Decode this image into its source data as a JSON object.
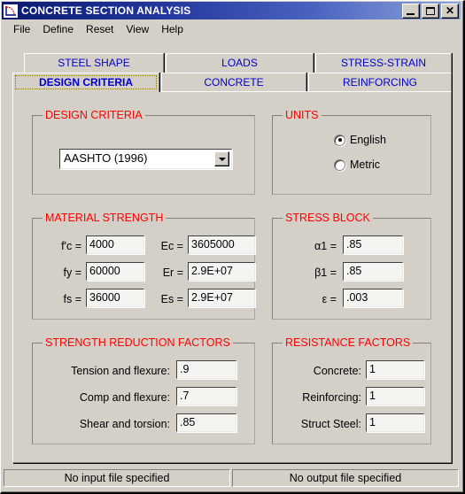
{
  "window": {
    "title": "CONCRETE SECTION ANALYSIS",
    "icon": "concrete-section-icon",
    "controls": {
      "minimize": "minimize-icon",
      "maximize": "maximize-icon",
      "close": "close-icon"
    }
  },
  "menu": {
    "items": [
      {
        "label": "File"
      },
      {
        "label": "Define"
      },
      {
        "label": "Reset"
      },
      {
        "label": "View"
      },
      {
        "label": "Help"
      }
    ]
  },
  "tabs": {
    "rows": [
      [
        {
          "label": "STEEL SHAPE",
          "selected": false
        },
        {
          "label": "LOADS",
          "selected": false
        },
        {
          "label": "STRESS-STRAIN",
          "selected": false
        }
      ],
      [
        {
          "label": "DESIGN CRITERIA",
          "selected": true
        },
        {
          "label": "CONCRETE",
          "selected": false
        },
        {
          "label": "REINFORCING",
          "selected": false
        }
      ]
    ],
    "selected": "DESIGN CRITERIA"
  },
  "groups": {
    "design_criteria": {
      "legend": "DESIGN CRITERIA",
      "combo": {
        "value": "AASHTO (1996)",
        "arrow_icon": "chevron-down-icon"
      }
    },
    "units": {
      "legend": "UNITS",
      "options": [
        {
          "label": "English",
          "selected": true
        },
        {
          "label": "Metric",
          "selected": false
        }
      ]
    },
    "material_strength": {
      "legend": "MATERIAL STRENGTH",
      "fields": [
        {
          "label": "f'c =",
          "value": "4000"
        },
        {
          "label": "fy =",
          "value": "60000"
        },
        {
          "label": "fs =",
          "value": "36000"
        },
        {
          "label": "Ec =",
          "value": "3605000"
        },
        {
          "label": "Er =",
          "value": "2.9E+07"
        },
        {
          "label": "Es =",
          "value": "2.9E+07"
        }
      ]
    },
    "stress_block": {
      "legend": "STRESS BLOCK",
      "fields": [
        {
          "label": "α1 =",
          "value": ".85"
        },
        {
          "label": "β1 =",
          "value": ".85"
        },
        {
          "label": "ε =",
          "value": ".003"
        }
      ]
    },
    "strength_reduction": {
      "legend": "STRENGTH REDUCTION FACTORS",
      "fields": [
        {
          "label": "Tension and flexure:",
          "value": ".9"
        },
        {
          "label": "Comp and flexure:",
          "value": ".7"
        },
        {
          "label": "Shear and torsion:",
          "value": ".85"
        }
      ]
    },
    "resistance_factors": {
      "legend": "RESISTANCE FACTORS",
      "fields": [
        {
          "label": "Concrete:",
          "value": "1"
        },
        {
          "label": "Reinforcing:",
          "value": "1"
        },
        {
          "label": "Struct Steel:",
          "value": "1"
        }
      ]
    }
  },
  "statusbar": {
    "input": "No input file specified",
    "output": "No output file specified"
  },
  "colors": {
    "face": "#d4d0c8",
    "legend_red": "#ff0000",
    "tab_blue": "#0000cd",
    "title_dark": "#0a1a6e",
    "title_light": "#8fa6da"
  }
}
